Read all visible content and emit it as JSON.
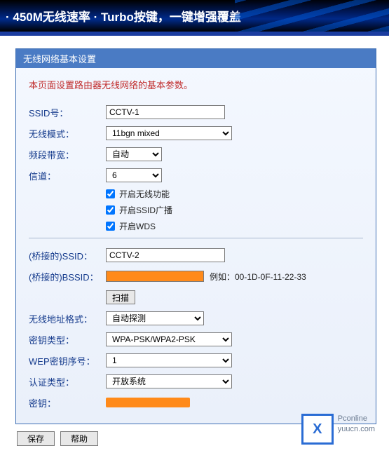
{
  "banner": "· 450M无线速率  · Turbo按键，一键增强覆盖",
  "panel": {
    "title": "无线网络基本设置"
  },
  "desc": "本页面设置路由器无线网络的基本参数。",
  "labels": {
    "ssid": "SSID号：",
    "mode": "无线模式：",
    "bandwidth": "频段带宽：",
    "channel": "信道：",
    "bridge_ssid": "(桥接的)SSID：",
    "bridge_bssid": "(桥接的)BSSID：",
    "addr_fmt": "无线地址格式：",
    "key_type": "密钥类型：",
    "wep_idx": "WEP密钥序号：",
    "auth_type": "认证类型：",
    "key": "密钥："
  },
  "values": {
    "ssid": "CCTV-1",
    "mode": "11bgn mixed",
    "bandwidth": "自动",
    "channel": "6",
    "bridge_ssid": "CCTV-2",
    "addr_fmt": "自动探测",
    "key_type": "WPA-PSK/WPA2-PSK",
    "wep_idx": "1",
    "auth_type": "开放系统"
  },
  "checkboxes": {
    "enable_wireless": "开启无线功能",
    "enable_ssid_broadcast": "开启SSID广播",
    "enable_wds": "开启WDS"
  },
  "hint_bssid": "例如：00-1D-0F-11-22-33",
  "buttons": {
    "scan": "扫描",
    "save": "保存",
    "help": "帮助"
  },
  "watermark": {
    "logo": "X",
    "line1": "Pconline",
    "line2": "yuucn.com"
  }
}
